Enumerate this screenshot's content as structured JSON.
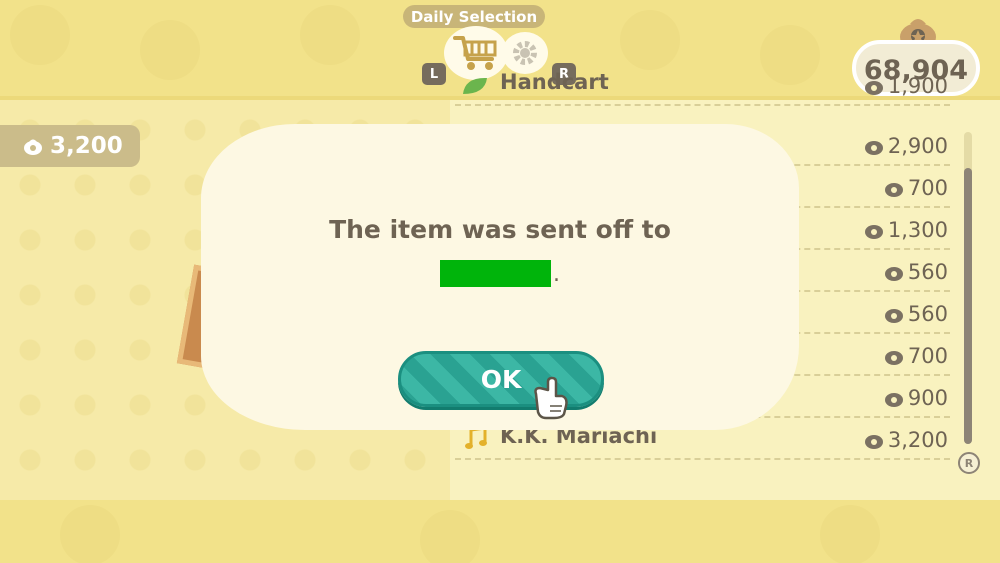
{
  "header": {
    "tab_label": "Daily Selection",
    "left_button": "L",
    "right_button": "R",
    "cart_icon": "shopping-cart-icon",
    "gear_icon": "gear-icon"
  },
  "wallet": {
    "bells": "68,904",
    "icon": "bell-bag-icon"
  },
  "selected_item": {
    "price": "3,200"
  },
  "list": {
    "rows": [
      {
        "name": "Handcart",
        "price": "1,900"
      },
      {
        "name": "",
        "price": "2,900"
      },
      {
        "name": "",
        "price": "700"
      },
      {
        "name": "",
        "price": "1,300"
      },
      {
        "name": "",
        "price": "560"
      },
      {
        "name": "",
        "price": "560"
      },
      {
        "name": "",
        "price": "700"
      },
      {
        "name": "",
        "price": "900"
      },
      {
        "name": "K.K. Mariachi",
        "price": "3,200"
      }
    ],
    "scroll_button": "R"
  },
  "dialog": {
    "message": "The item was sent off to",
    "recipient_suffix": ".",
    "ok_label": "OK"
  },
  "colors": {
    "background": "#f9f2bf",
    "text": "#6e6353",
    "ok_button": "#2aa292",
    "redaction": "#00b40b"
  }
}
